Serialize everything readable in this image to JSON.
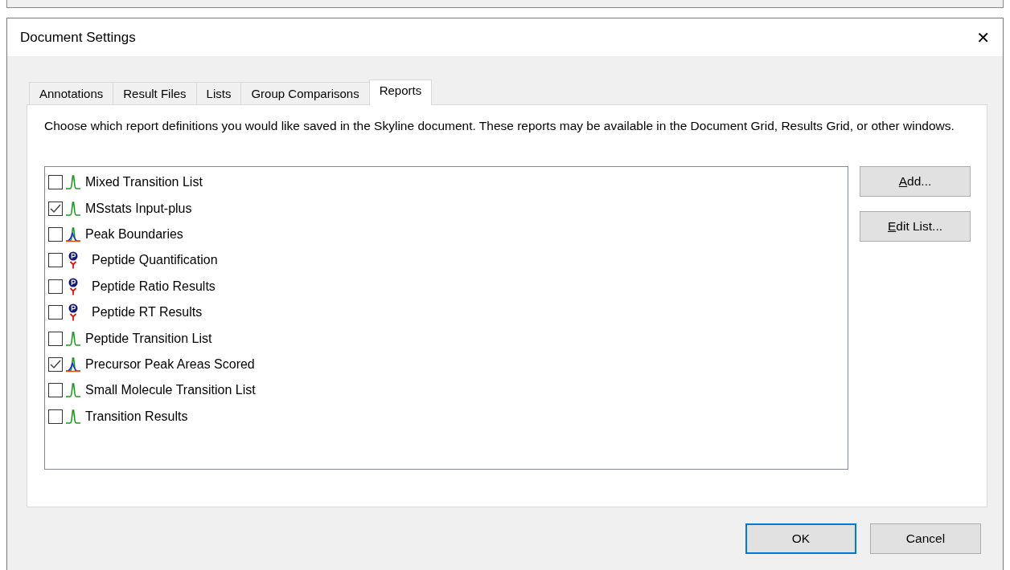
{
  "window": {
    "title": "Document Settings",
    "close": "✕"
  },
  "tabs": [
    {
      "label": "Annotations",
      "selected": false
    },
    {
      "label": "Result Files",
      "selected": false
    },
    {
      "label": "Lists",
      "selected": false
    },
    {
      "label": "Group Comparisons",
      "selected": false
    },
    {
      "label": "Reports",
      "selected": true
    }
  ],
  "description": "Choose which report definitions you would like saved in the Skyline document. These reports may be available in the Document Grid, Results Grid, or other windows.",
  "reports": [
    {
      "label": "Mixed Transition List",
      "checked": false,
      "kind": "peak"
    },
    {
      "label": "MSstats Input-plus",
      "checked": true,
      "kind": "peak"
    },
    {
      "label": "Peak Boundaries",
      "checked": false,
      "kind": "multipeak"
    },
    {
      "label": "Peptide Quantification",
      "checked": false,
      "kind": "peptide"
    },
    {
      "label": "Peptide Ratio Results",
      "checked": false,
      "kind": "peptide"
    },
    {
      "label": "Peptide RT Results",
      "checked": false,
      "kind": "peptide"
    },
    {
      "label": "Peptide Transition List",
      "checked": false,
      "kind": "peak"
    },
    {
      "label": "Precursor Peak Areas Scored",
      "checked": true,
      "kind": "multipeak"
    },
    {
      "label": "Small Molecule Transition List",
      "checked": false,
      "kind": "peak"
    },
    {
      "label": "Transition Results",
      "checked": false,
      "kind": "peak"
    }
  ],
  "side_buttons": [
    "Add...",
    "Edit List..."
  ],
  "footer_buttons": [
    {
      "label": "OK",
      "selected": true
    },
    {
      "label": "Cancel",
      "selected": false
    }
  ]
}
